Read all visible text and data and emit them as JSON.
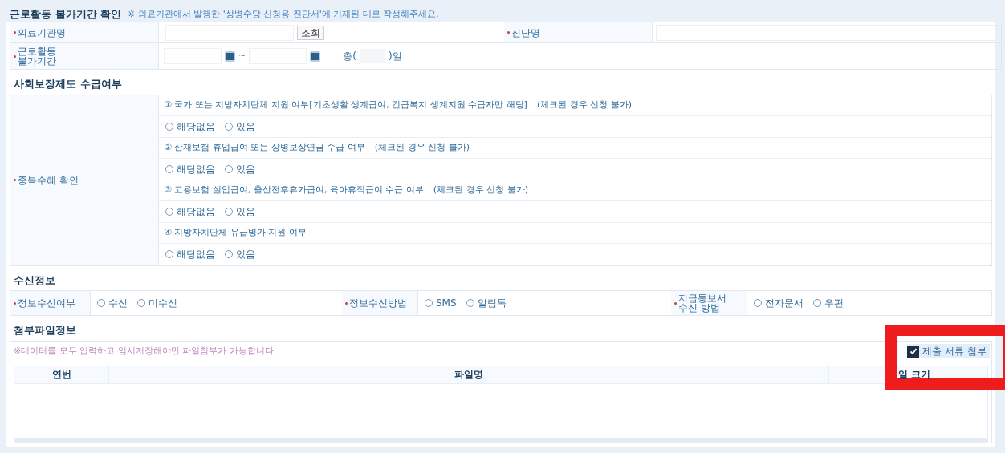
{
  "period": {
    "title": "근로활동 불가기간 확인",
    "note": "※ 의료기관에서 발행한 '상병수당 신청용 진단서'에 기재된 대로 작성해주세요.",
    "hospital_label": "의료기관명",
    "search_button": "조회",
    "diagnosis_label": "진단명",
    "period_label": [
      "근로활동",
      "불가기간"
    ],
    "tilde": "~",
    "total_prefix": "총(",
    "total_suffix": ")일"
  },
  "benefits": {
    "title": "사회보장제도 수급여부",
    "label": "중복수혜 확인",
    "questions": [
      {
        "text": "① 국가 또는 지방자치단체 지원 여부[기초생활 생계급여, 긴급복지 생계지원 수급자만 해당]",
        "note": "(체크된 경우 신청 불가)",
        "options": [
          {
            "label": "해당없음",
            "selected": false
          },
          {
            "label": "있음",
            "selected": false
          }
        ]
      },
      {
        "text": "② 산재보험 휴업급여 또는 상병보상연금 수급 여부",
        "note": "(체크된 경우 신청 불가)",
        "options": [
          {
            "label": "해당없음",
            "selected": false
          },
          {
            "label": "있음",
            "selected": false
          }
        ]
      },
      {
        "text": "③ 고용보험 실업급여, 출산전후휴가급여, 육아휴직급여 수급 여부",
        "note": "(체크된 경우 신청 불가)",
        "options": [
          {
            "label": "해당없음",
            "selected": false
          },
          {
            "label": "있음",
            "selected": false
          }
        ]
      },
      {
        "text": "④ 지방자치단체 유급병가 지원 여부",
        "options": [
          {
            "label": "해당없음",
            "selected": false
          },
          {
            "label": "있음",
            "selected": false
          }
        ]
      }
    ]
  },
  "receive": {
    "title": "수신정보",
    "fields": [
      {
        "label": [
          "정보수신여부"
        ],
        "options": [
          {
            "label": "수신",
            "selected": false
          },
          {
            "label": "미수신",
            "selected": false
          }
        ]
      },
      {
        "label": [
          "정보수신방법"
        ],
        "options": [
          {
            "label": "SMS",
            "selected": false
          },
          {
            "label": "알림톡",
            "selected": false
          }
        ]
      },
      {
        "label": [
          "지급통보서",
          "수신 방법"
        ],
        "options": [
          {
            "label": "전자문서",
            "selected": false
          },
          {
            "label": "우편",
            "selected": false
          }
        ]
      }
    ]
  },
  "attachments": {
    "title": "첨부파일정보",
    "notice": "※데이터를 모두 입력하고 임시저장해야만 파일첨부가 가능합니다.",
    "attach_checkbox": {
      "label": "제출 서류 첨부",
      "checked": true
    },
    "columns": [
      "연번",
      "파일명",
      "일 크기"
    ]
  }
}
